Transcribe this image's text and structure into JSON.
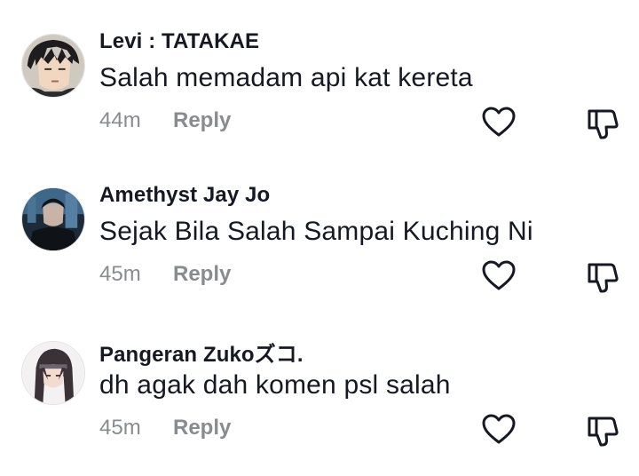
{
  "comments": [
    {
      "username": "Levi : TATAKAE",
      "text": "Salah memadam api kat kereta",
      "time": "44m",
      "reply_label": "Reply"
    },
    {
      "username": "Amethyst Jay Jo",
      "text": "Sejak Bila Salah Sampai Kuching Ni",
      "time": "45m",
      "reply_label": "Reply"
    },
    {
      "username": "Pangeran Zukoズコ.",
      "text": "dh agak dah komen psl salah",
      "time": "45m",
      "reply_label": "Reply"
    }
  ],
  "icons": {
    "like": "heart-outline-icon",
    "dislike": "thumbs-down-outline-icon"
  },
  "colors": {
    "text": "#161823",
    "secondary": "#8a8b91"
  }
}
